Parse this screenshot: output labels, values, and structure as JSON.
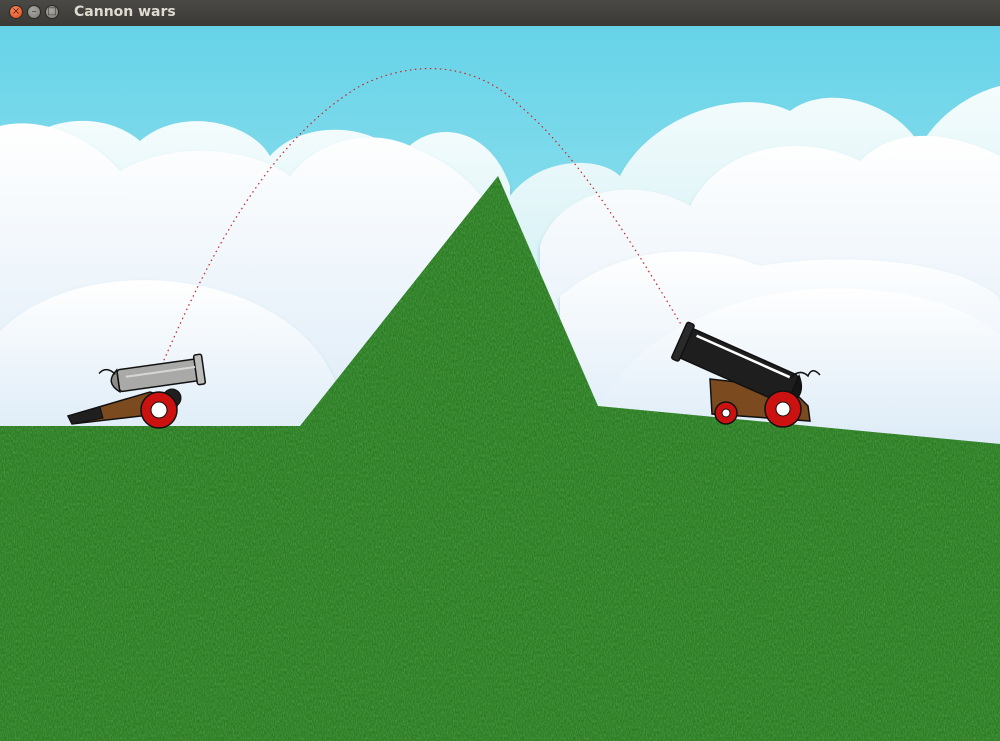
{
  "window": {
    "title": "Cannon wars",
    "close_glyph": "×",
    "minimize_glyph": "–",
    "maximize_glyph": "□"
  },
  "colors": {
    "sky_top": "#67d3e8",
    "sky_bottom": "#c9f2f7",
    "grass": "#2b7d22",
    "grass_dark": "#1c5a15",
    "trajectory": "#cc2222",
    "left_cannon_barrel": "#a9aaa8",
    "right_cannon_barrel": "#1e1e1e",
    "carriage_wood": "#7b4a1e",
    "wheel_red": "#cc1111"
  },
  "icons": {
    "close": "close-icon",
    "minimize": "minimize-icon",
    "maximize": "maximize-icon"
  }
}
